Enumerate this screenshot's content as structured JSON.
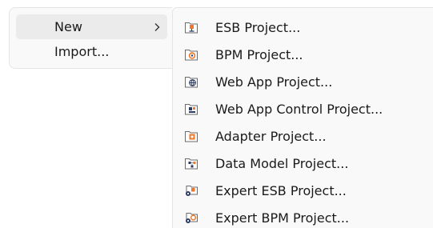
{
  "main_menu": {
    "items": [
      {
        "label": "New",
        "has_submenu": true,
        "selected": true
      },
      {
        "label": "Import...",
        "has_submenu": false,
        "selected": false
      }
    ]
  },
  "submenu": {
    "items": [
      {
        "label": "ESB Project...",
        "icon": "esb-project-icon"
      },
      {
        "label": "BPM Project...",
        "icon": "bpm-project-icon"
      },
      {
        "label": "Web App Project...",
        "icon": "web-app-project-icon"
      },
      {
        "label": "Web App Control Project...",
        "icon": "web-app-control-project-icon"
      },
      {
        "label": "Adapter Project...",
        "icon": "adapter-project-icon"
      },
      {
        "label": "Data Model Project...",
        "icon": "data-model-project-icon"
      },
      {
        "label": "Expert ESB Project...",
        "icon": "expert-esb-project-icon"
      },
      {
        "label": "Expert BPM Project...",
        "icon": "expert-bpm-project-icon"
      }
    ]
  },
  "colors": {
    "menu_background": "#f9f9f9",
    "selected_item": "#ebebeb",
    "icon_orange": "#f0782a",
    "icon_dark": "#2b3a67",
    "icon_outline": "#6b6b6b"
  }
}
